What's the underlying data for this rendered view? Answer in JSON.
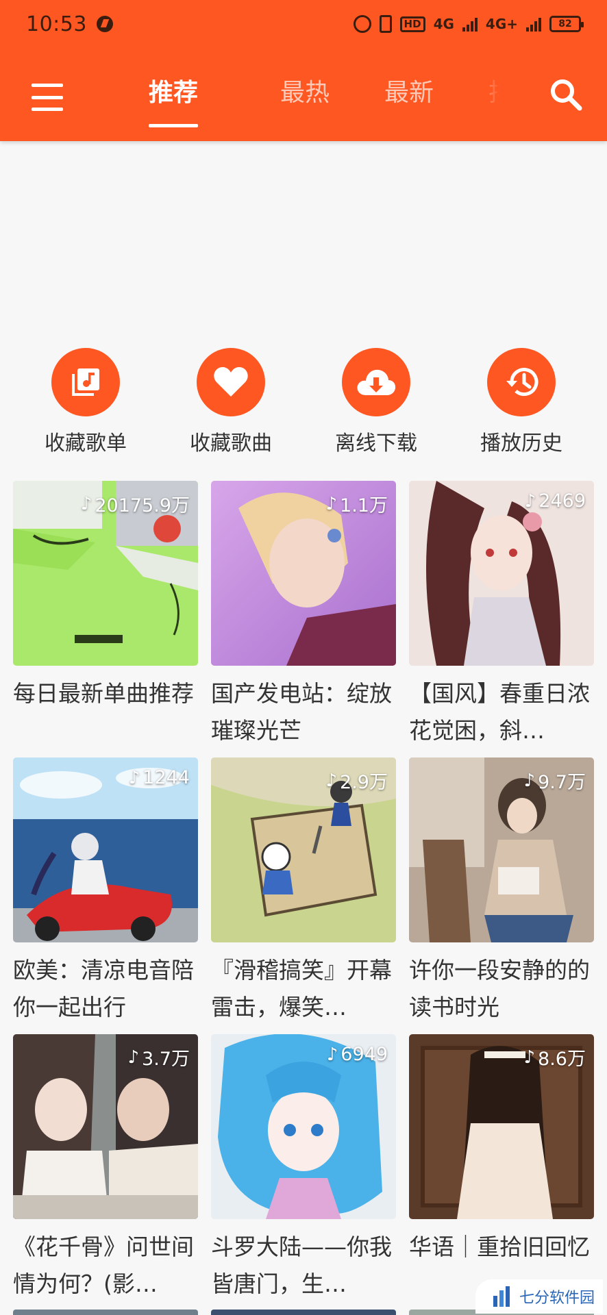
{
  "status_bar": {
    "time": "10:53",
    "hd": "HD",
    "net1": "4G",
    "net2": "4G+",
    "battery": "82"
  },
  "header": {
    "tabs": [
      {
        "label": "推荐",
        "active": true
      },
      {
        "label": "最热"
      },
      {
        "label": "最新"
      },
      {
        "label": "排行"
      }
    ],
    "accent_color": "#ff5722"
  },
  "quick_actions": [
    {
      "label": "收藏歌单",
      "icon": "playlist-icon"
    },
    {
      "label": "收藏歌曲",
      "icon": "heart-icon"
    },
    {
      "label": "离线下载",
      "icon": "cloud-download-icon"
    },
    {
      "label": "播放历史",
      "icon": "history-icon"
    }
  ],
  "playlists": [
    {
      "title": "每日最新单曲推荐",
      "plays": "20175.9万"
    },
    {
      "title": "国产发电站：绽放璀璨光芒",
      "plays": "1.1万"
    },
    {
      "title": "【国风】春重日浓花觉困，斜…",
      "plays": "2469"
    },
    {
      "title": "欧美：清凉电音陪你一起出行",
      "plays": "1244"
    },
    {
      "title": "『滑稽搞笑』开幕雷击，爆笑…",
      "plays": "2.9万"
    },
    {
      "title": "许你一段安静的的读书时光",
      "plays": "9.7万"
    },
    {
      "title": "《花千骨》问世间情为何？(影…",
      "plays": "3.7万"
    },
    {
      "title": "斗罗大陆——你我皆唐门，生…",
      "plays": "6949"
    },
    {
      "title": "华语｜重拾旧回忆",
      "plays": "8.6万"
    }
  ],
  "watermark": {
    "text": "七分软件园"
  }
}
